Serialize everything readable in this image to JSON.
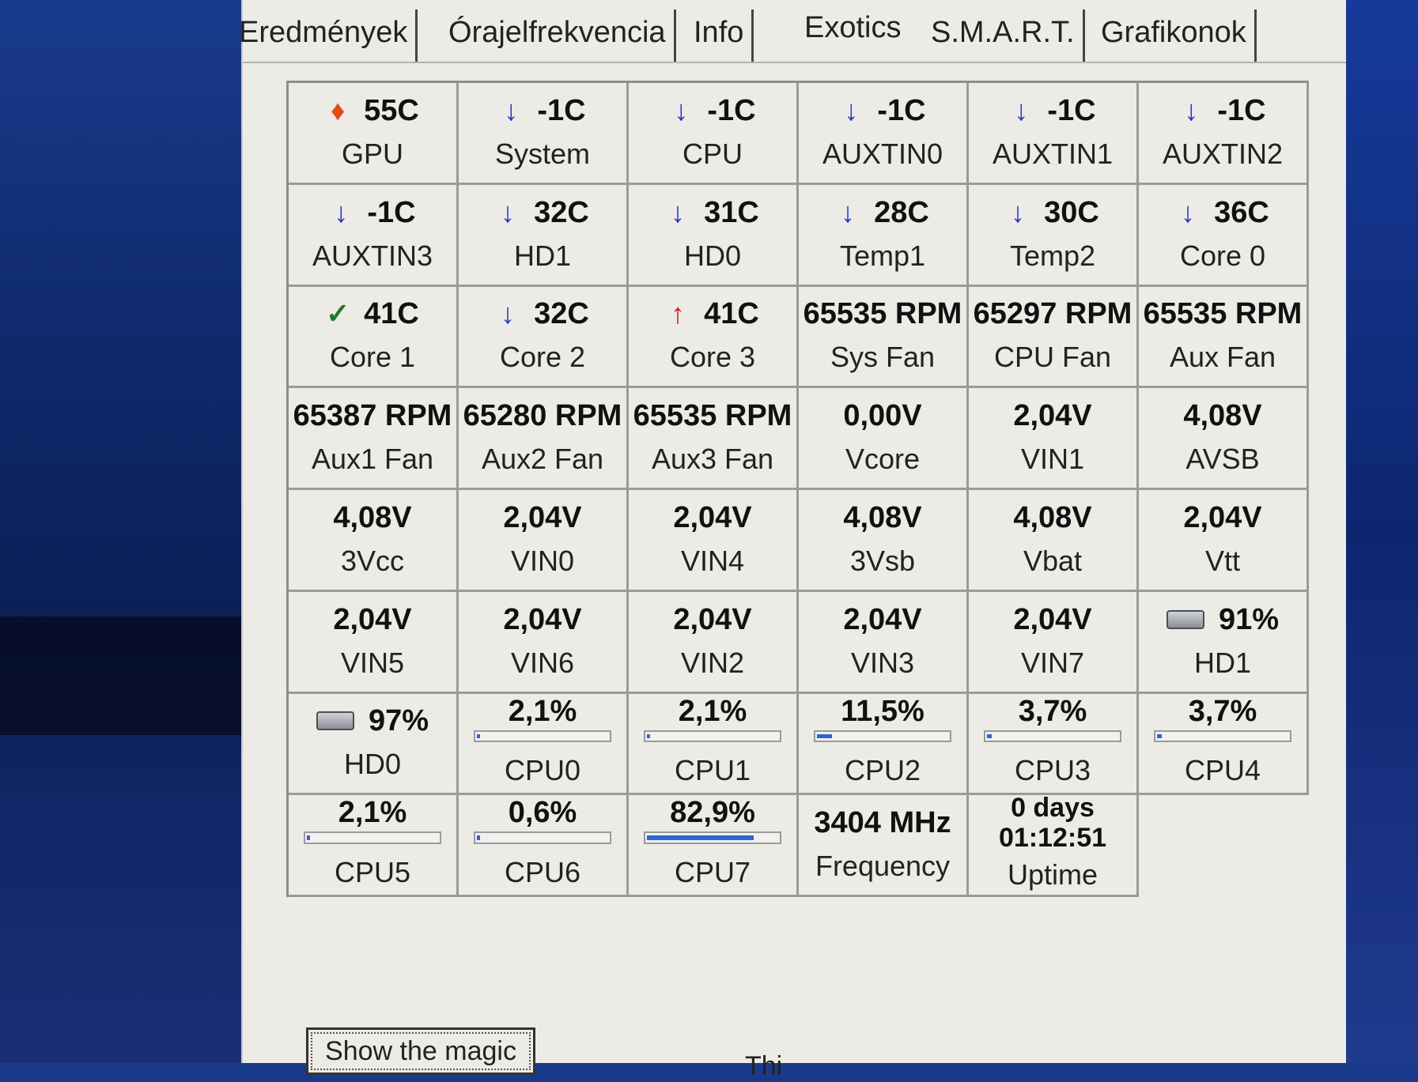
{
  "tabs": [
    {
      "label": "Eredmények"
    },
    {
      "label": "Órajelfrekvencia"
    },
    {
      "label": "Info"
    },
    {
      "label": "Exotics"
    },
    {
      "label": "S.M.A.R.T."
    },
    {
      "label": "Grafikonok"
    }
  ],
  "active_tab": "Exotics",
  "sensors": [
    {
      "value": "55C",
      "label": "GPU",
      "icon": "flame-icon"
    },
    {
      "value": "-1C",
      "label": "System",
      "icon": "arrow-down-icon"
    },
    {
      "value": "-1C",
      "label": "CPU",
      "icon": "arrow-down-icon"
    },
    {
      "value": "-1C",
      "label": "AUXTIN0",
      "icon": "arrow-down-icon"
    },
    {
      "value": "-1C",
      "label": "AUXTIN1",
      "icon": "arrow-down-icon"
    },
    {
      "value": "-1C",
      "label": "AUXTIN2",
      "icon": "arrow-down-icon"
    },
    {
      "value": "-1C",
      "label": "AUXTIN3",
      "icon": "arrow-down-icon"
    },
    {
      "value": "32C",
      "label": "HD1",
      "icon": "arrow-down-icon"
    },
    {
      "value": "31C",
      "label": "HD0",
      "icon": "arrow-down-icon"
    },
    {
      "value": "28C",
      "label": "Temp1",
      "icon": "arrow-down-icon"
    },
    {
      "value": "30C",
      "label": "Temp2",
      "icon": "arrow-down-icon"
    },
    {
      "value": "36C",
      "label": "Core 0",
      "icon": "arrow-down-icon"
    },
    {
      "value": "41C",
      "label": "Core 1",
      "icon": "check-icon"
    },
    {
      "value": "32C",
      "label": "Core 2",
      "icon": "arrow-down-icon"
    },
    {
      "value": "41C",
      "label": "Core 3",
      "icon": "arrow-up-icon"
    },
    {
      "value": "65535 RPM",
      "label": "Sys Fan",
      "icon": ""
    },
    {
      "value": "65297 RPM",
      "label": "CPU Fan",
      "icon": ""
    },
    {
      "value": "65535 RPM",
      "label": "Aux Fan",
      "icon": ""
    },
    {
      "value": "65387 RPM",
      "label": "Aux1 Fan",
      "icon": ""
    },
    {
      "value": "65280 RPM",
      "label": "Aux2 Fan",
      "icon": ""
    },
    {
      "value": "65535 RPM",
      "label": "Aux3 Fan",
      "icon": ""
    },
    {
      "value": "0,00V",
      "label": "Vcore",
      "icon": ""
    },
    {
      "value": "2,04V",
      "label": "VIN1",
      "icon": ""
    },
    {
      "value": "4,08V",
      "label": "AVSB",
      "icon": ""
    },
    {
      "value": "4,08V",
      "label": "3Vcc",
      "icon": ""
    },
    {
      "value": "2,04V",
      "label": "VIN0",
      "icon": ""
    },
    {
      "value": "2,04V",
      "label": "VIN4",
      "icon": ""
    },
    {
      "value": "4,08V",
      "label": "3Vsb",
      "icon": ""
    },
    {
      "value": "4,08V",
      "label": "Vbat",
      "icon": ""
    },
    {
      "value": "2,04V",
      "label": "Vtt",
      "icon": ""
    },
    {
      "value": "2,04V",
      "label": "VIN5",
      "icon": ""
    },
    {
      "value": "2,04V",
      "label": "VIN6",
      "icon": ""
    },
    {
      "value": "2,04V",
      "label": "VIN2",
      "icon": ""
    },
    {
      "value": "2,04V",
      "label": "VIN3",
      "icon": ""
    },
    {
      "value": "2,04V",
      "label": "VIN7",
      "icon": ""
    },
    {
      "value": "91%",
      "label": "HD1",
      "icon": "disk-icon"
    },
    {
      "value": "97%",
      "label": "HD0",
      "icon": "disk-icon"
    },
    {
      "value": "2,1%",
      "label": "CPU0",
      "bar": 2.1
    },
    {
      "value": "2,1%",
      "label": "CPU1",
      "bar": 2.1
    },
    {
      "value": "11,5%",
      "label": "CPU2",
      "bar": 11.5
    },
    {
      "value": "3,7%",
      "label": "CPU3",
      "bar": 3.7
    },
    {
      "value": "3,7%",
      "label": "CPU4",
      "bar": 3.7
    },
    {
      "value": "2,1%",
      "label": "CPU5",
      "bar": 2.1
    },
    {
      "value": "0,6%",
      "label": "CPU6",
      "bar": 0.6
    },
    {
      "value": "82,9%",
      "label": "CPU7",
      "bar": 82.9
    },
    {
      "value": "3404 MHz",
      "label": "Frequency",
      "icon": ""
    },
    {
      "value": "0 days 01:12:51",
      "label": "Uptime",
      "uptime": [
        "0 days",
        "01:12:51"
      ]
    }
  ],
  "button": {
    "label": "Show the magic"
  },
  "footer_text": "Thi"
}
